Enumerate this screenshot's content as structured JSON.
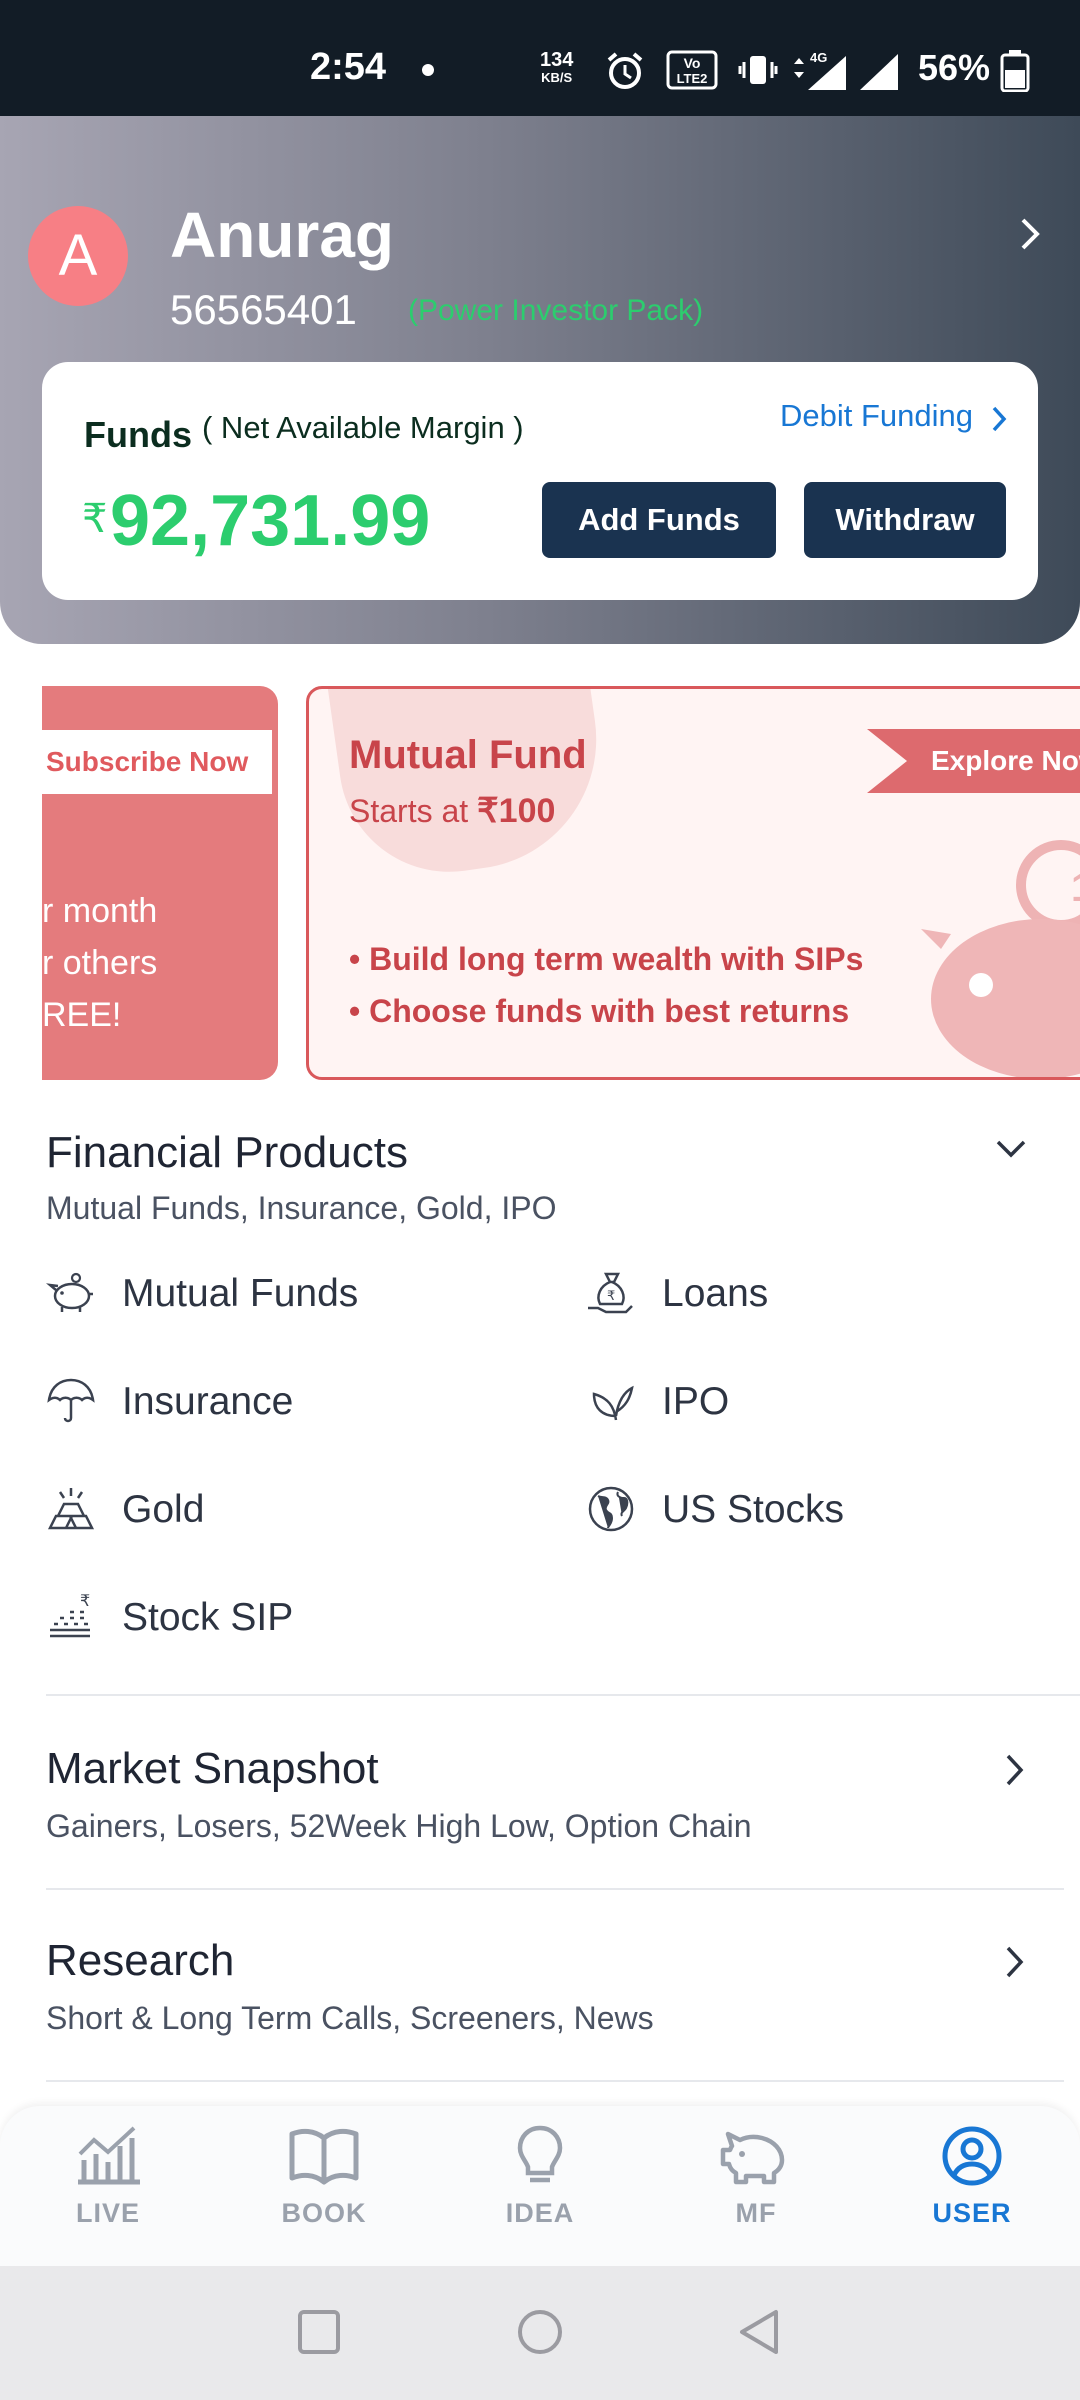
{
  "status_bar": {
    "time": "2:54",
    "net_speed": "134",
    "net_unit": "KB/S",
    "battery": "56%"
  },
  "profile": {
    "avatar_letter": "A",
    "name": "Anurag",
    "client_id": "56565401",
    "pack": "(Power Investor Pack)"
  },
  "funds": {
    "label": "Funds",
    "sublabel": "( Net Available Margin )",
    "debit_funding": "Debit Funding",
    "currency": "₹",
    "amount": "92,731.99",
    "add_funds": "Add Funds",
    "withdraw": "Withdraw"
  },
  "banners": {
    "left": {
      "tag": "Subscribe Now",
      "lines": [
        "r month",
        "r others",
        "REE!"
      ]
    },
    "right": {
      "title": "Mutual Fund",
      "subtitle_prefix": "Starts at",
      "subtitle_value": "₹100",
      "tag": "Explore Now",
      "bullets": [
        "• Build long term wealth with SIPs",
        "• Choose funds with best returns"
      ]
    }
  },
  "financial_products": {
    "title": "Financial Products",
    "subtitle": "Mutual Funds, Insurance, Gold, IPO",
    "items": [
      {
        "label": "Mutual Funds",
        "icon": "piggy-bank-icon"
      },
      {
        "label": "Loans",
        "icon": "money-bag-icon"
      },
      {
        "label": "Insurance",
        "icon": "umbrella-icon"
      },
      {
        "label": "IPO",
        "icon": "sprout-icon"
      },
      {
        "label": "Gold",
        "icon": "gold-bars-icon"
      },
      {
        "label": "US Stocks",
        "icon": "globe-icon"
      },
      {
        "label": "Stock SIP",
        "icon": "rupee-bars-icon"
      }
    ]
  },
  "market_snapshot": {
    "title": "Market Snapshot",
    "subtitle": "Gainers, Losers, 52Week High Low, Option Chain"
  },
  "research": {
    "title": "Research",
    "subtitle": "Short & Long Term Calls, Screeners, News"
  },
  "bottom_nav": {
    "items": [
      {
        "label": "LIVE",
        "icon": "chart-icon"
      },
      {
        "label": "BOOK",
        "icon": "book-icon"
      },
      {
        "label": "IDEA",
        "icon": "bulb-icon"
      },
      {
        "label": "MF",
        "icon": "piggy-bank-icon"
      },
      {
        "label": "USER",
        "icon": "user-circle-icon"
      }
    ],
    "active": "USER",
    "active_color": "#1877d4",
    "inactive_color": "#9aa1ac"
  },
  "colors": {
    "accent_green": "#2ccd6e",
    "button_navy": "#1a3350",
    "link_blue": "#1877d4",
    "banner_red": "#d9585b"
  }
}
